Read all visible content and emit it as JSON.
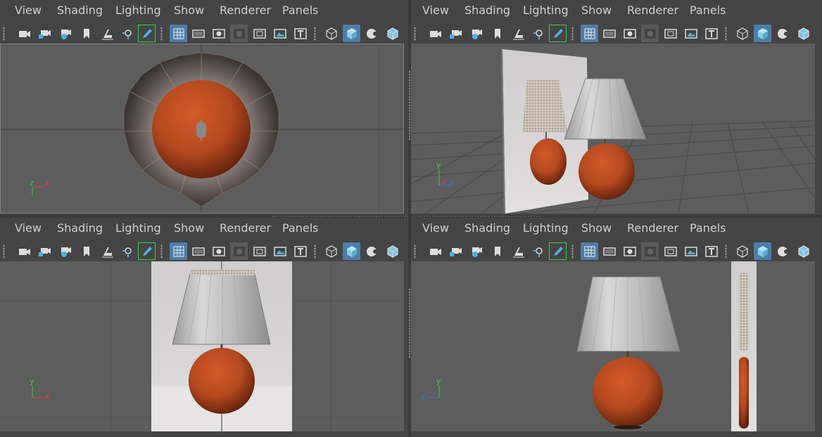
{
  "menu": [
    "View",
    "Shading",
    "Lighting",
    "Show",
    "Renderer",
    "Panels"
  ],
  "toolbar_icons": [
    "camera-icon",
    "camera-lock-icon",
    "camera-attributes-icon",
    "bookmark-icon",
    "image-plane-icon",
    "track-view-icon",
    "grease-pencil-icon",
    "grid-icon",
    "film-gate-icon",
    "resolution-gate-icon",
    "gate-mask-icon",
    "field-chart-icon",
    "safe-action-icon",
    "safe-title-icon",
    "wireframe-icon",
    "smooth-shade-icon",
    "use-default-material-icon",
    "wireframe-on-shaded-icon"
  ],
  "panels": [
    {
      "id": "top",
      "view": "top",
      "axes": {
        "up": "z",
        "right": "x"
      }
    },
    {
      "id": "persp",
      "view": "perspective",
      "axes": {
        "up": "y",
        "right": "z"
      }
    },
    {
      "id": "front",
      "view": "front",
      "axes": {
        "up": "y",
        "right": "x"
      }
    },
    {
      "id": "side",
      "view": "side",
      "axes": {
        "up": "y",
        "right": "z"
      }
    }
  ],
  "colors": {
    "background": "#444444",
    "viewport": "#5d5d5d",
    "accent": "#4d7ea8",
    "lamp_base": "#b4491f",
    "lamp_shade": "#c8c8c8",
    "axis_x": "#e23a3a",
    "axis_y": "#3ccc3c",
    "axis_z": "#3a6cf0"
  }
}
